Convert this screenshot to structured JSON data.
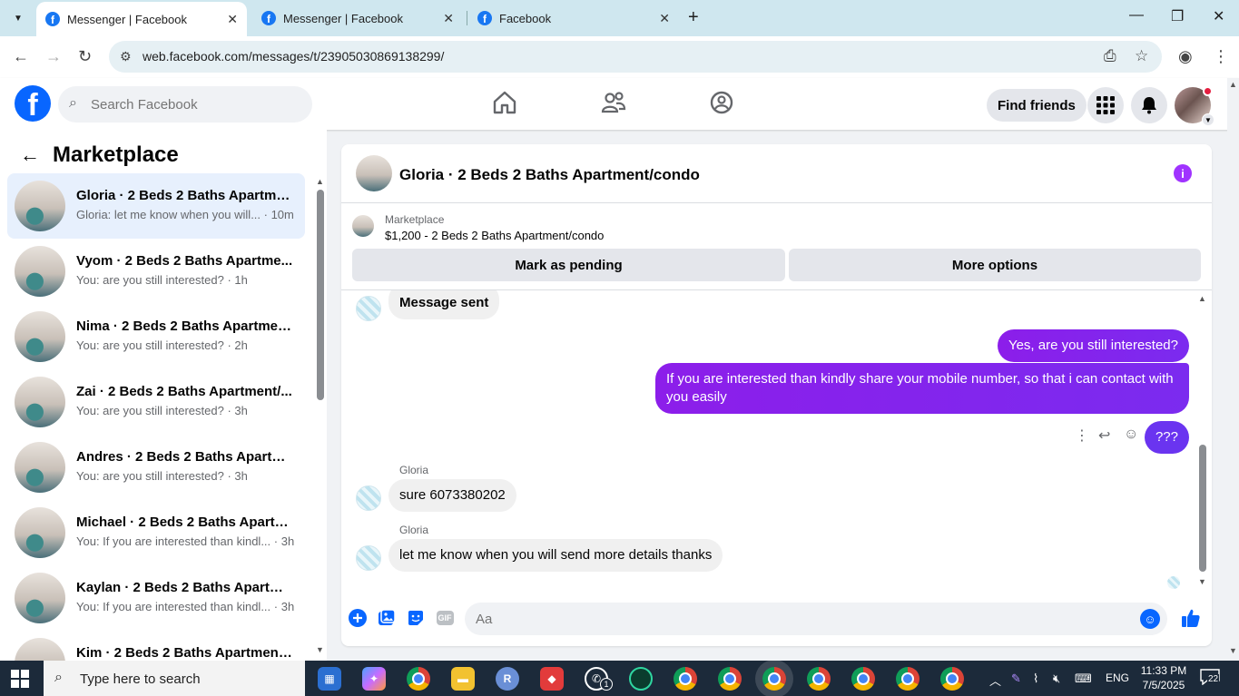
{
  "browser": {
    "tabs": [
      {
        "title": "Messenger | Facebook",
        "active": true
      },
      {
        "title": "Messenger | Facebook",
        "active": false
      },
      {
        "title": "Facebook",
        "active": false
      }
    ],
    "url": "web.facebook.com/messages/t/23905030869138299/"
  },
  "fb_header": {
    "logo_letter": "f",
    "search_placeholder": "Search Facebook",
    "find_friends_label": "Find friends"
  },
  "sidebar": {
    "title": "Marketplace",
    "conversations": [
      {
        "name": "Gloria · 2 Beds 2 Baths Apartme...",
        "snippet": "Gloria: let me know when you will... · 10m",
        "active": true
      },
      {
        "name": "Vyom · 2 Beds 2 Baths Apartme...",
        "snippet": "You: are you still interested? · 1h",
        "active": false
      },
      {
        "name": "Nima · 2 Beds 2 Baths Apartmen...",
        "snippet": "You: are you still interested? · 2h",
        "active": false
      },
      {
        "name": "Zai · 2 Beds 2 Baths Apartment/...",
        "snippet": "You: are you still interested? · 3h",
        "active": false
      },
      {
        "name": "Andres · 2 Beds 2 Baths Apartm...",
        "snippet": "You: are you still interested? · 3h",
        "active": false
      },
      {
        "name": "Michael · 2 Beds 2 Baths Apartm...",
        "snippet": "You: If you are interested than kindl... · 3h",
        "active": false
      },
      {
        "name": "Kaylan · 2 Beds 2 Baths Apartme...",
        "snippet": "You: If you are interested than kindl... · 3h",
        "active": false
      },
      {
        "name": "Kim · 2 Beds 2 Baths Apartment...",
        "snippet": "",
        "active": false
      }
    ]
  },
  "chat": {
    "title": "Gloria · 2 Beds 2 Baths Apartment/condo",
    "listing_source": "Marketplace",
    "listing_title": "$1,200 - 2 Beds 2 Baths Apartment/condo",
    "mark_pending_label": "Mark as pending",
    "more_options_label": "More options",
    "messages": {
      "m1": "Message sent",
      "m2": "Yes, are you still interested?",
      "m3": "If you are interested than kindly share your mobile number, so that i can contact with you easily",
      "m4": "???",
      "sender1": "Gloria",
      "m5": "sure 6073380202",
      "sender2": "Gloria",
      "m6": "let me know when you will send more details  thanks"
    },
    "composer_placeholder": "Aa",
    "gif_label": "GIF"
  },
  "taskbar": {
    "search_placeholder": "Type here to search",
    "language": "ENG",
    "time": "11:33 PM",
    "date": "7/5/2025",
    "notifications": "22",
    "whatsapp_badge": "1"
  },
  "colors": {
    "fb_blue": "#0866ff",
    "outgoing_bubble": "#7b2bef",
    "active_conversation": "#e7f0fd",
    "taskbar": "#1c2a3a"
  }
}
